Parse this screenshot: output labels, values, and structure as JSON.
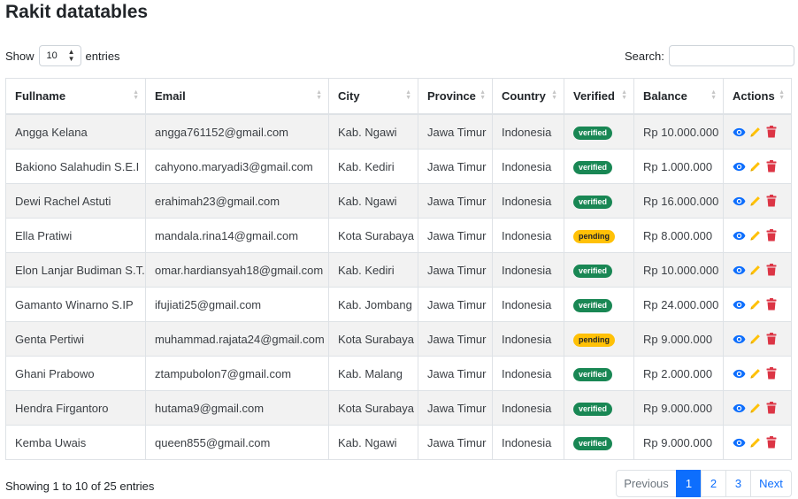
{
  "page": {
    "title": "Rakit datatables"
  },
  "length": {
    "show_label": "Show",
    "selected": "10",
    "entries_label": "entries"
  },
  "search": {
    "label": "Search:",
    "value": "",
    "placeholder": ""
  },
  "table": {
    "columns": [
      "Fullname",
      "Email",
      "City",
      "Province",
      "Country",
      "Verified",
      "Balance",
      "Actions"
    ],
    "rows": [
      {
        "fullname": "Angga Kelana",
        "email": "angga761152@gmail.com",
        "city": "Kab. Ngawi",
        "province": "Jawa Timur",
        "country": "Indonesia",
        "verified": "verified",
        "balance": "Rp 10.000.000"
      },
      {
        "fullname": "Bakiono Salahudin S.E.I",
        "email": "cahyono.maryadi3@gmail.com",
        "city": "Kab. Kediri",
        "province": "Jawa Timur",
        "country": "Indonesia",
        "verified": "verified",
        "balance": "Rp 1.000.000"
      },
      {
        "fullname": "Dewi Rachel Astuti",
        "email": "erahimah23@gmail.com",
        "city": "Kab. Ngawi",
        "province": "Jawa Timur",
        "country": "Indonesia",
        "verified": "verified",
        "balance": "Rp 16.000.000"
      },
      {
        "fullname": "Ella Pratiwi",
        "email": "mandala.rina14@gmail.com",
        "city": "Kota Surabaya",
        "province": "Jawa Timur",
        "country": "Indonesia",
        "verified": "pending",
        "balance": "Rp 8.000.000"
      },
      {
        "fullname": "Elon Lanjar Budiman S.T.",
        "email": "omar.hardiansyah18@gmail.com",
        "city": "Kab. Kediri",
        "province": "Jawa Timur",
        "country": "Indonesia",
        "verified": "verified",
        "balance": "Rp 10.000.000"
      },
      {
        "fullname": "Gamanto Winarno S.IP",
        "email": "ifujiati25@gmail.com",
        "city": "Kab. Jombang",
        "province": "Jawa Timur",
        "country": "Indonesia",
        "verified": "verified",
        "balance": "Rp 24.000.000"
      },
      {
        "fullname": "Genta Pertiwi",
        "email": "muhammad.rajata24@gmail.com",
        "city": "Kota Surabaya",
        "province": "Jawa Timur",
        "country": "Indonesia",
        "verified": "pending",
        "balance": "Rp 9.000.000"
      },
      {
        "fullname": "Ghani Prabowo",
        "email": "ztampubolon7@gmail.com",
        "city": "Kab. Malang",
        "province": "Jawa Timur",
        "country": "Indonesia",
        "verified": "verified",
        "balance": "Rp 2.000.000"
      },
      {
        "fullname": "Hendra Firgantoro",
        "email": "hutama9@gmail.com",
        "city": "Kota Surabaya",
        "province": "Jawa Timur",
        "country": "Indonesia",
        "verified": "verified",
        "balance": "Rp 9.000.000"
      },
      {
        "fullname": "Kemba Uwais",
        "email": "queen855@gmail.com",
        "city": "Kab. Ngawi",
        "province": "Jawa Timur",
        "country": "Indonesia",
        "verified": "verified",
        "balance": "Rp 9.000.000"
      }
    ],
    "action_icons": [
      "eye-icon",
      "pencil-icon",
      "trash-icon"
    ]
  },
  "info": {
    "text": "Showing 1 to 10 of 25 entries"
  },
  "pagination": {
    "previous": "Previous",
    "pages": [
      "1",
      "2",
      "3"
    ],
    "active": "1",
    "next": "Next"
  },
  "colors": {
    "primary": "#0d6efd",
    "success": "#198754",
    "warning": "#ffc107",
    "danger": "#dc3545",
    "edit": "#ffc107"
  }
}
